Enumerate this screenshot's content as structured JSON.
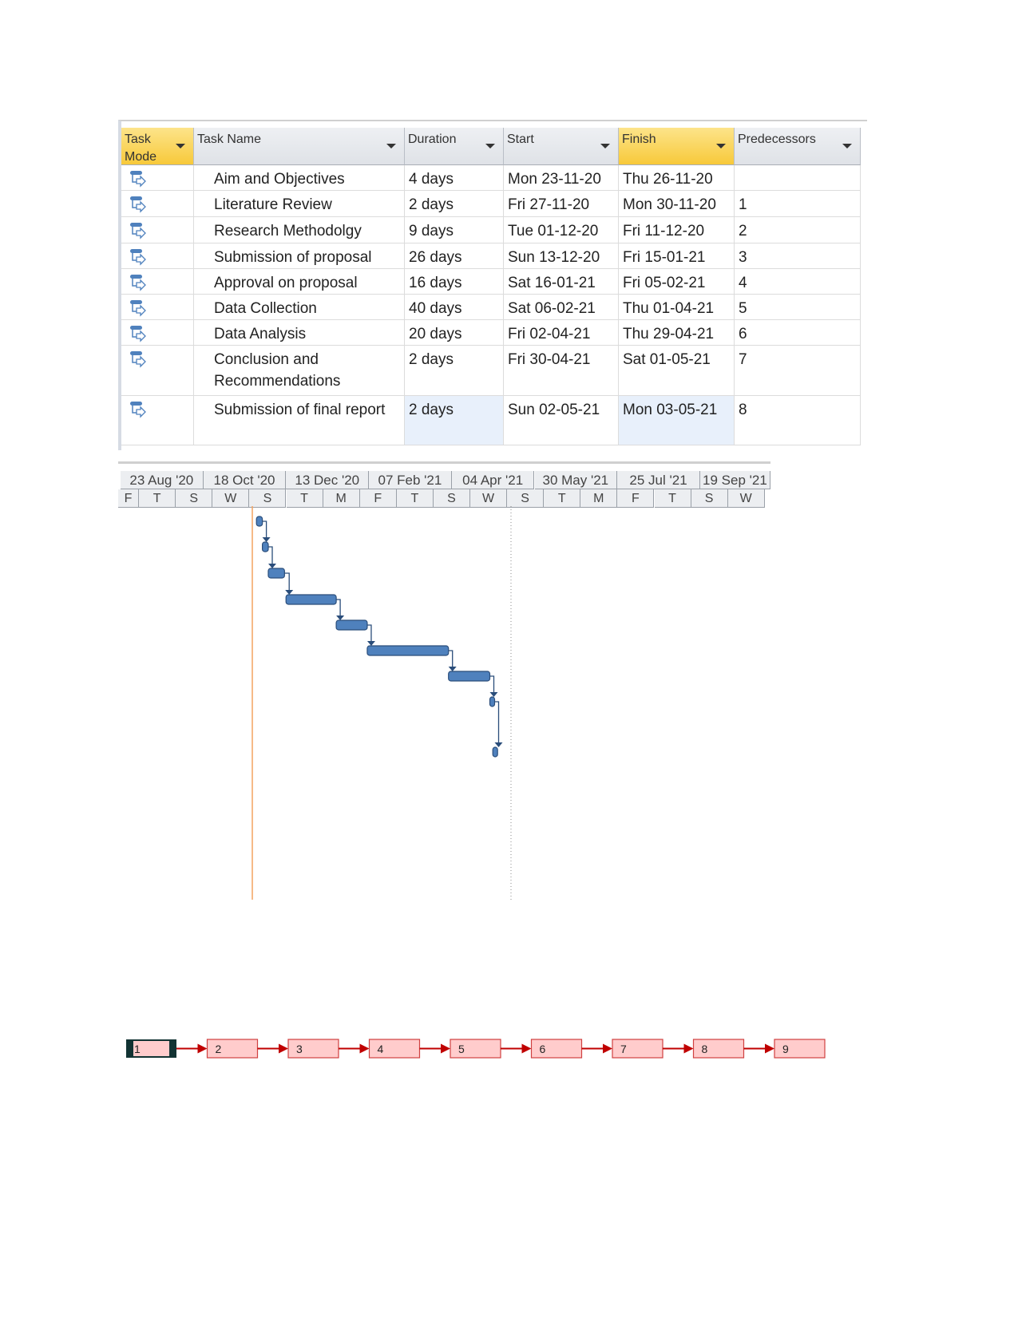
{
  "table": {
    "columns": [
      {
        "label": "Task Mode",
        "selected": true
      },
      {
        "label": "Task Name",
        "selected": false
      },
      {
        "label": "Duration",
        "selected": false
      },
      {
        "label": "Start",
        "selected": false
      },
      {
        "label": "Finish",
        "selected": true
      },
      {
        "label": "Predecessors",
        "selected": false
      }
    ],
    "rows": [
      {
        "id": 1,
        "name": "Aim and Objectives",
        "duration": "4 days",
        "start": "Mon 23-11-20",
        "finish": "Thu 26-11-20",
        "pred": ""
      },
      {
        "id": 2,
        "name": "Literature Review",
        "duration": "2 days",
        "start": "Fri 27-11-20",
        "finish": "Mon 30-11-20",
        "pred": "1"
      },
      {
        "id": 3,
        "name": "Research Methodolgy",
        "duration": "9 days",
        "start": "Tue 01-12-20",
        "finish": "Fri 11-12-20",
        "pred": "2"
      },
      {
        "id": 4,
        "name": "Submission of proposal",
        "duration": "26 days",
        "start": "Sun 13-12-20",
        "finish": "Fri 15-01-21",
        "pred": "3"
      },
      {
        "id": 5,
        "name": "Approval on proposal",
        "duration": "16 days",
        "start": "Sat 16-01-21",
        "finish": "Fri 05-02-21",
        "pred": "4"
      },
      {
        "id": 6,
        "name": "Data Collection",
        "duration": "40 days",
        "start": "Sat 06-02-21",
        "finish": "Thu 01-04-21",
        "pred": "5"
      },
      {
        "id": 7,
        "name": "Data Analysis",
        "duration": "20 days",
        "start": "Fri 02-04-21",
        "finish": "Thu 29-04-21",
        "pred": "6"
      },
      {
        "id": 8,
        "name": "Conclusion and Recommendations",
        "duration": "2 days",
        "start": "Fri 30-04-21",
        "finish": "Sat 01-05-21",
        "pred": "7"
      },
      {
        "id": 9,
        "name": "Submission of final report",
        "duration": "2 days",
        "start": "Sun 02-05-21",
        "finish": "Mon 03-05-21",
        "pred": "8"
      }
    ],
    "task_mode_icon": "auto-scheduled-task-icon"
  },
  "gantt": {
    "major_tier": [
      "23 Aug '20",
      "18 Oct '20",
      "13 Dec '20",
      "07 Feb '21",
      "04 Apr '21",
      "30 May '21",
      "25 Jul '21",
      "19 Sep '21"
    ],
    "minor_tier": [
      "F",
      "T",
      "S",
      "W",
      "S",
      "T",
      "M",
      "F",
      "T",
      "S",
      "W",
      "S",
      "T",
      "M",
      "F",
      "T",
      "S",
      "W"
    ],
    "bar_color": "#4f81bd",
    "today_line_color": "#f4a460"
  },
  "network": {
    "nodes": [
      "1",
      "2",
      "3",
      "4",
      "5",
      "6",
      "7",
      "8",
      "9"
    ],
    "node_fill": "#ffcccc",
    "link_color": "#c00000"
  }
}
